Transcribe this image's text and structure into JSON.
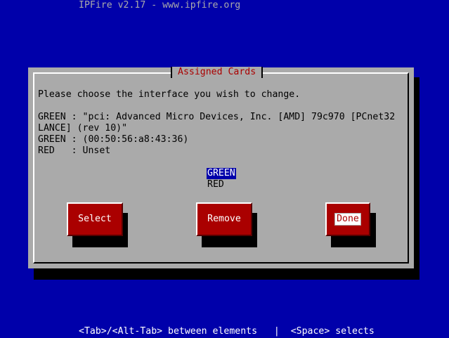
{
  "window": {
    "title": "IPFire v2.17 - www.ipfire.org"
  },
  "dialog": {
    "title": "Assigned Cards",
    "prompt": "Please choose the interface you wish to change.",
    "info_lines": [
      "GREEN : \"pci: Advanced Micro Devices, Inc. [AMD] 79c970 [PCnet32",
      "LANCE] (rev 10)\"",
      "GREEN : (00:50:56:a8:43:36)",
      "RED   : Unset"
    ],
    "list": {
      "items": [
        "GREEN",
        "RED"
      ],
      "selected": "GREEN"
    },
    "buttons": {
      "select_label": "Select",
      "remove_label": "Remove",
      "done_label": "Done",
      "focused": "Done"
    }
  },
  "help_bar": {
    "text": "<Tab>/<Alt-Tab> between elements   |  <Space> selects"
  },
  "colors": {
    "background": "#0000aa",
    "dialog": "#aaaaaa",
    "title_text": "#aa0000",
    "button": "#aa0000",
    "button_text": "#ffffff",
    "selection": "#0000aa"
  }
}
